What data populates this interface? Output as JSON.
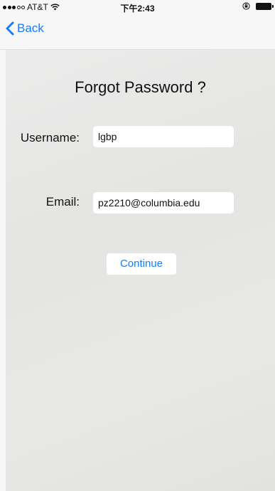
{
  "status_bar": {
    "carrier": "AT&T",
    "time": "下午2:43"
  },
  "nav": {
    "back_label": "Back"
  },
  "form": {
    "title": "Forgot Password ?",
    "username_label": "Username:",
    "username_value": "lgbp",
    "email_label": "Email:",
    "email_value": "pz2210@columbia.edu",
    "continue_label": "Continue"
  },
  "colors": {
    "accent": "#1a7cf5",
    "background": "#e8e8e6"
  }
}
